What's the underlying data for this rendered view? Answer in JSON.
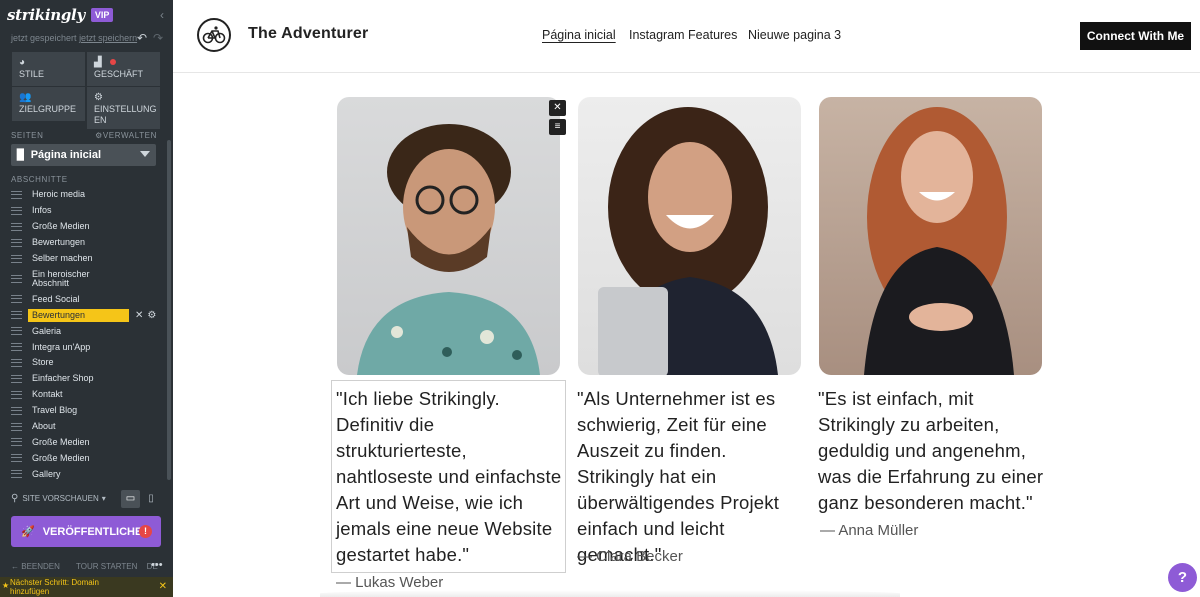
{
  "editor": {
    "logo": "strikingly",
    "badge": "VIP",
    "saved_text": "jetzt gespeichert",
    "save_link": "jetzt speichern",
    "tiles": [
      {
        "label": "STILE",
        "icon": "palette-icon"
      },
      {
        "label": "GESCHÄFT",
        "icon": "shopping-bag-icon",
        "has_dot": true
      },
      {
        "label": "ZIELGRUPPE",
        "icon": "people-icon"
      },
      {
        "label": "EINSTELLUNG EN",
        "icon": "gear-icon"
      }
    ],
    "pages_label": "SEITEN",
    "manage_label": "VERWALTEN",
    "current_page": "Página inicial",
    "sections_label": "ABSCHNITTE",
    "sections": [
      "Heroic media",
      "Infos",
      "Große Medien",
      "Bewertungen",
      "Selber machen",
      "Ein heroischer Abschnitt",
      "Feed Social",
      "Bewertungen",
      "Galeria",
      "Integra un'App",
      "Store",
      "Einfacher Shop",
      "Kontakt",
      "Travel Blog",
      "About",
      "Große Medien",
      "Große Medien",
      "Gallery"
    ],
    "active_section_index": 7,
    "preview_label": "SITE VORSCHAUEN",
    "publish_label": "VERÖFFENTLICHEN",
    "publish_alert": "!",
    "bottom_links": [
      "BEENDEN",
      "TOUR STARTEN",
      "DE"
    ],
    "next_step": "Nächster Schritt: Domain hinzufügen"
  },
  "site": {
    "title": "The Adventurer",
    "nav": [
      "Página inicial",
      "Instagram Features",
      "Nieuwe pagina 3"
    ],
    "cta": "Connect With Me"
  },
  "testimonials": [
    {
      "quote": "\"Ich liebe Strikingly. Definitiv die strukturierteste, nahtloseste und einfachste Art und Weise, wie ich jemals eine neue Website gestartet habe.\"",
      "author": "— Lukas Weber"
    },
    {
      "quote": "\"Als Unternehmer ist es schwierig, Zeit für eine Auszeit zu finden. Strikingly hat ein überwältigendes Projekt einfach und leicht gemacht.\"",
      "author": "— Clara Becker"
    },
    {
      "quote": "\"Es ist einfach, mit Strikingly zu arbeiten, geduldig und angenehm, was die Erfahrung zu einer ganz besonderen macht.\"",
      "author": "— Anna Müller"
    }
  ],
  "help_label": "?"
}
